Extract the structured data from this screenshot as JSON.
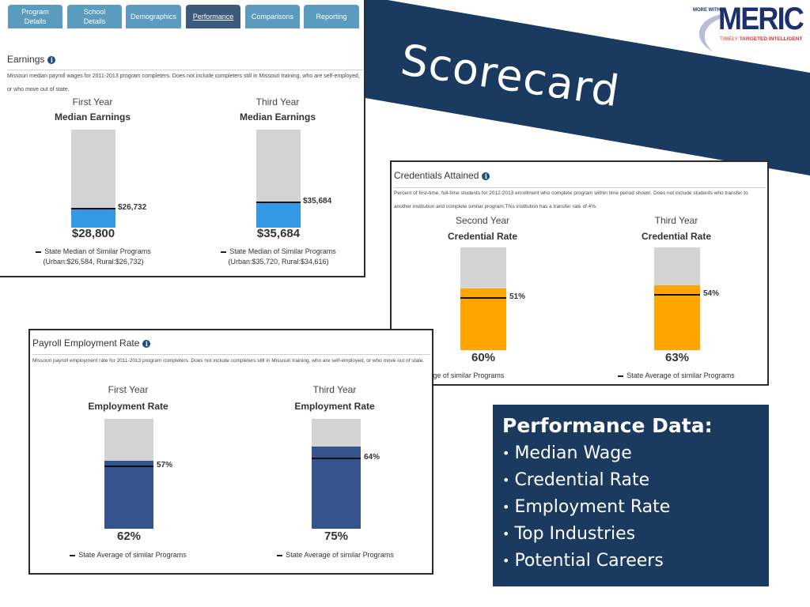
{
  "slide": {
    "title": "Scorecard",
    "logo": {
      "prefix": "MORE WITH",
      "name": "MERIC",
      "tagline_1": "TIMELY",
      "tagline_2": "TARGETED INTELLIGENT"
    },
    "colors": {
      "banner": "#1a3a5f",
      "earnings_fill": "#3399e6",
      "credential_fill": "#ffa500",
      "employment_fill": "#35548e",
      "bar_background": "#d3d3d3",
      "tab": "#5b9bbd",
      "tab_active": "#3c5a7c"
    }
  },
  "tabs": [
    {
      "label": "Program\nDetails",
      "active": false
    },
    {
      "label": "School\nDetails",
      "active": false
    },
    {
      "label": "Demographics",
      "active": false
    },
    {
      "label": "Performance",
      "active": true
    },
    {
      "label": "Comparisons",
      "active": false
    },
    {
      "label": "Reporting",
      "active": false
    }
  ],
  "earnings": {
    "title": "Earnings",
    "description": "Missouri median payroll wages for 2011-2013 program completers. Does not include completers still in Missouri training, who are self-employed, or who move out of state.",
    "scale_max": 140000,
    "columns": [
      {
        "period": "First Year",
        "metric": "Median Earnings",
        "value": 28800,
        "value_label": "$28,800",
        "marker": 26732,
        "marker_label": "$26,732",
        "legend": "State Median of Similar Programs",
        "legend_detail": "(Urban:$26,584, Rural:$26,732)"
      },
      {
        "period": "Third Year",
        "metric": "Median Earnings",
        "value": 35684,
        "value_label": "$35,684",
        "marker": 35684,
        "marker_label": "$35,684",
        "legend": "State Median of Similar Programs",
        "legend_detail": "(Urban:$35,720, Rural:$34,616)"
      }
    ]
  },
  "credentials": {
    "title": "Credentials Attained",
    "description": "Percent of first-time, full-time students for 2012-2013 enrollment who complete program within time period shown. Does not include students who transfer to another institution and complete similar program.This institution has a transfer rate of 4%.",
    "scale_max": 100,
    "columns": [
      {
        "period": "Second Year",
        "metric": "Credential Rate",
        "value": 60,
        "value_label": "60%",
        "marker": 51,
        "marker_label": "51%",
        "legend": "State Average of similar Programs"
      },
      {
        "period": "Third Year",
        "metric": "Credential Rate",
        "value": 63,
        "value_label": "63%",
        "marker": 54,
        "marker_label": "54%",
        "legend": "State Average of similar Programs"
      }
    ]
  },
  "employment": {
    "title": "Payroll Employment Rate",
    "description": "Missouri payroll employment rate for 2011-2013 program completers. Does not include completers still in Missouri training, who are self-employed, or who move out of state.",
    "scale_max": 100,
    "columns": [
      {
        "period": "First Year",
        "metric": "Employment Rate",
        "value": 62,
        "value_label": "62%",
        "marker": 57,
        "marker_label": "57%",
        "legend": "State Average of similar Programs"
      },
      {
        "period": "Third Year",
        "metric": "Employment Rate",
        "value": 75,
        "value_label": "75%",
        "marker": 64,
        "marker_label": "64%",
        "legend": "State Average of similar Programs"
      }
    ]
  },
  "performance_box": {
    "title": "Performance Data:",
    "items": [
      "Median Wage",
      "Credential Rate",
      "Employment Rate",
      "Top Industries",
      "Potential Careers"
    ]
  }
}
